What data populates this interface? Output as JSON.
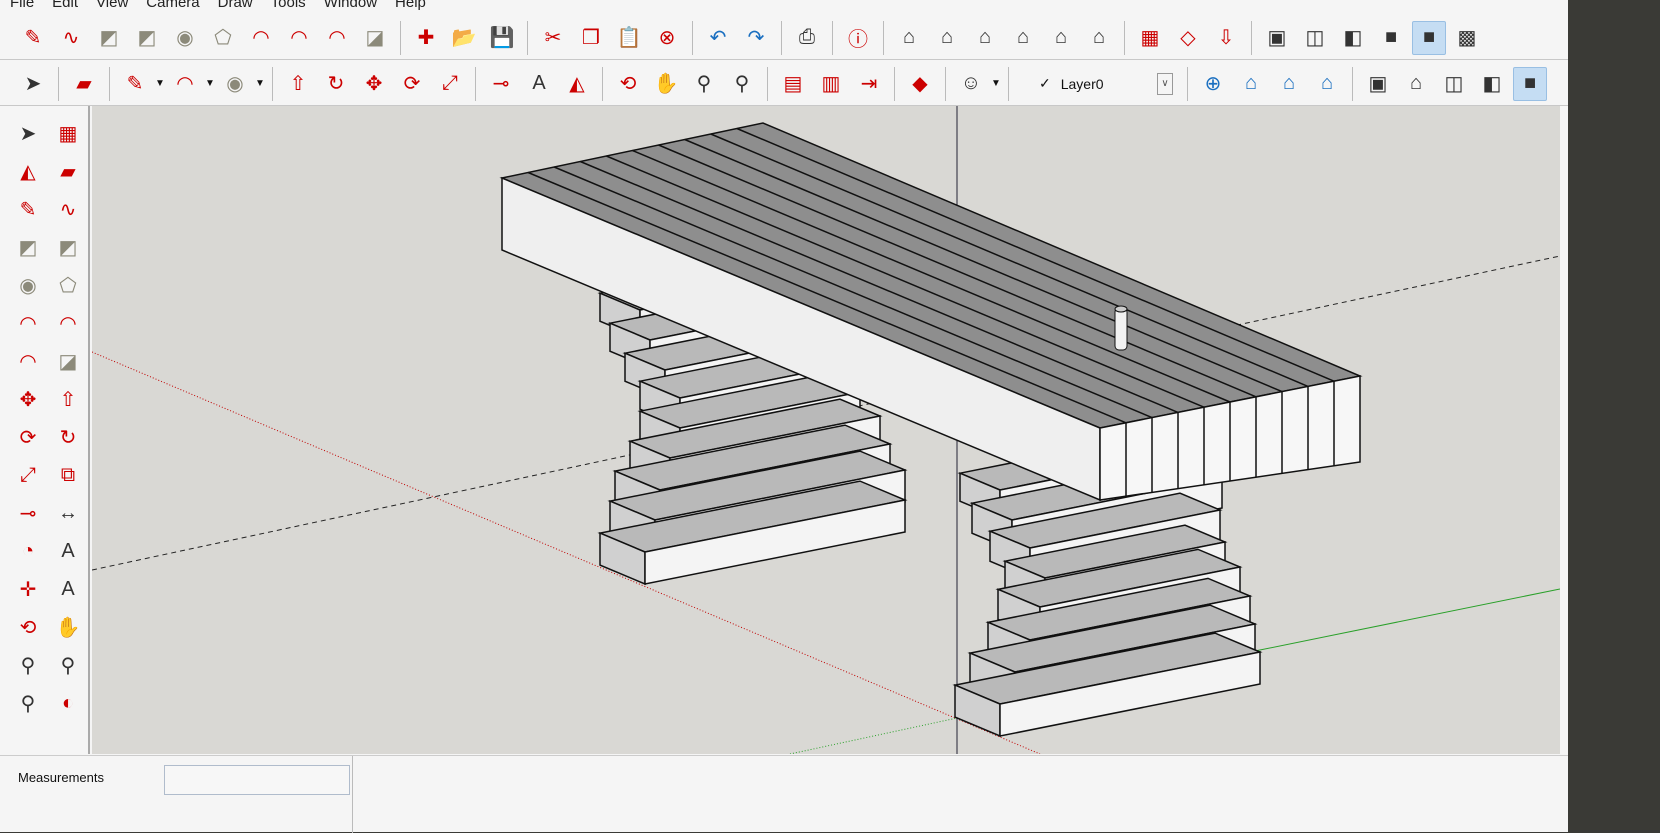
{
  "menu": [
    "File",
    "Edit",
    "View",
    "Camera",
    "Draw",
    "Tools",
    "Window",
    "Help"
  ],
  "toolbar1": [
    "pencil-icon",
    "freehand-icon",
    "rectangle-icon",
    "rotated-rectangle-icon",
    "circle-icon",
    "polygon-icon",
    "arc-icon",
    "two-point-arc-icon",
    "three-point-arc-icon",
    "pie-icon",
    "|",
    "new-file-icon",
    "open-folder-icon",
    "save-icon",
    "|",
    "cut-icon",
    "copy-icon",
    "paste-icon",
    "erase-icon",
    "|",
    "undo-icon",
    "redo-icon",
    "|",
    "print-icon",
    "|",
    "model-info-icon",
    "|",
    "iso-view-icon",
    "top-view-icon",
    "front-view-icon",
    "right-view-icon",
    "back-view-icon",
    "left-view-icon",
    "|",
    "add-location-icon",
    "toggle-terrain-icon",
    "get-models-icon",
    "|",
    "xray-style-icon",
    "wireframe-back-edges-icon",
    "hidden-line-style-icon",
    "shaded-style-icon",
    "shaded-textures-style-icon*",
    "monochrome-style-icon"
  ],
  "toolbar2_left": [
    "select-icon",
    "|",
    "eraser-icon",
    "|",
    "pencil-icon",
    "v",
    "arc-icon",
    "v",
    "circle-icon",
    "v",
    "|",
    "push-pull-icon",
    "follow-me-icon",
    "move-icon",
    "rotate-icon",
    "scale-icon",
    "|",
    "tape-measure-icon",
    "text-icon",
    "paint-bucket-icon",
    "|",
    "orbit-icon",
    "pan-icon",
    "zoom-icon",
    "zoom-extents-icon",
    "|",
    "components-icon",
    "materials-icon",
    "send-to-layout-icon",
    "|",
    "extension-warehouse-icon",
    "|",
    "account-icon",
    "v",
    "|"
  ],
  "layer": {
    "check": "✓",
    "name": "Layer0"
  },
  "toolbar2_right": [
    "|",
    "section-plane-icon",
    "display-section-planes-icon",
    "display-section-cuts-icon",
    "display-section-fill-icon",
    "|",
    "xray-icon",
    "back-edges-icon",
    "wireframe-icon",
    "hidden-line-icon",
    "shaded-icon*"
  ],
  "lefttools": [
    "select-icon",
    "make-component-icon",
    "paint-bucket-icon",
    "eraser-icon",
    "pencil-icon",
    "freehand-icon",
    "rectangle-icon",
    "rotated-rectangle-icon",
    "circle-icon",
    "polygon-icon",
    "arc-icon",
    "two-point-arc-icon",
    "three-point-arc-icon",
    "pie-icon",
    "move-icon",
    "push-pull-icon",
    "rotate-icon",
    "follow-me-icon",
    "scale-icon",
    "offset-icon",
    "tape-measure-icon",
    "dimension-icon",
    "protractor-icon",
    "text-icon",
    "axes-icon",
    "3d-text-icon",
    "orbit-icon",
    "pan-icon",
    "zoom-icon",
    "zoom-window-icon",
    "zoom-extents-icon",
    "previous-view-icon"
  ],
  "status": {
    "measurements_label": "Measurements",
    "measurements_value": ""
  },
  "colors": {
    "viewport": "#d9d8d4",
    "selected": "#c5ddf3",
    "red_axis": "#c00000",
    "green_axis": "#2aa02a",
    "blue_axis": "#1c1cc0"
  }
}
